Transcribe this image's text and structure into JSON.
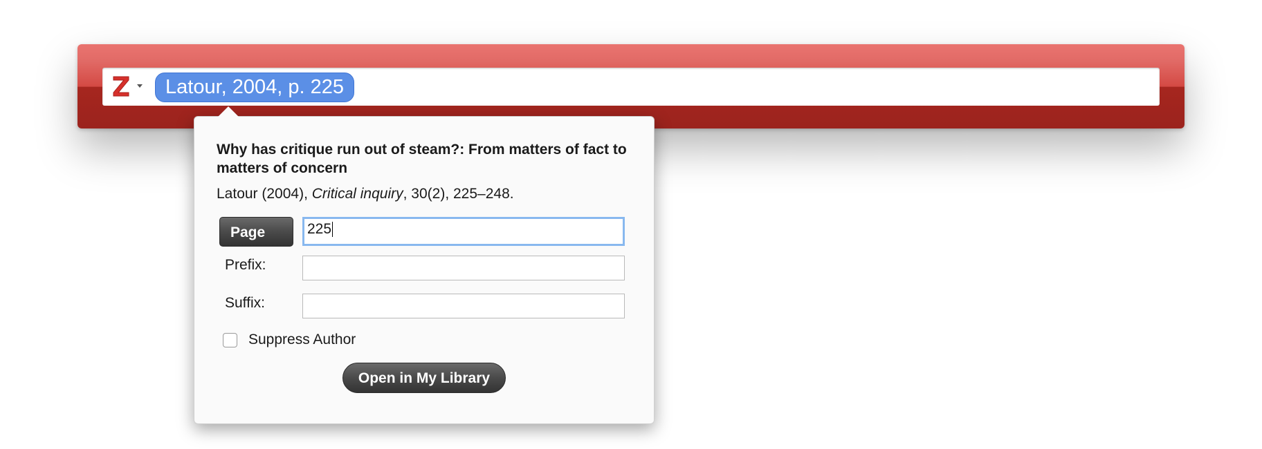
{
  "quick_format": {
    "logo_icon": "zotero-z-logo",
    "accent_color": "#c0302a",
    "citation_bubble": "Latour, 2004, p. 225",
    "bubble_color": "#5b8fe6"
  },
  "popover": {
    "title": "Why has critique run out of steam?: From matters of fact to matters of concern",
    "citation_prefix": "Latour (2004), ",
    "citation_journal": "Critical inquiry",
    "citation_suffix": ", 30(2), 225–248.",
    "locator_label": "Page",
    "locator_value": "225",
    "prefix_label": "Prefix:",
    "prefix_value": "",
    "suffix_label": "Suffix:",
    "suffix_value": "",
    "suppress_author_label": "Suppress Author",
    "suppress_author_checked": false,
    "open_library_label": "Open in My Library"
  }
}
